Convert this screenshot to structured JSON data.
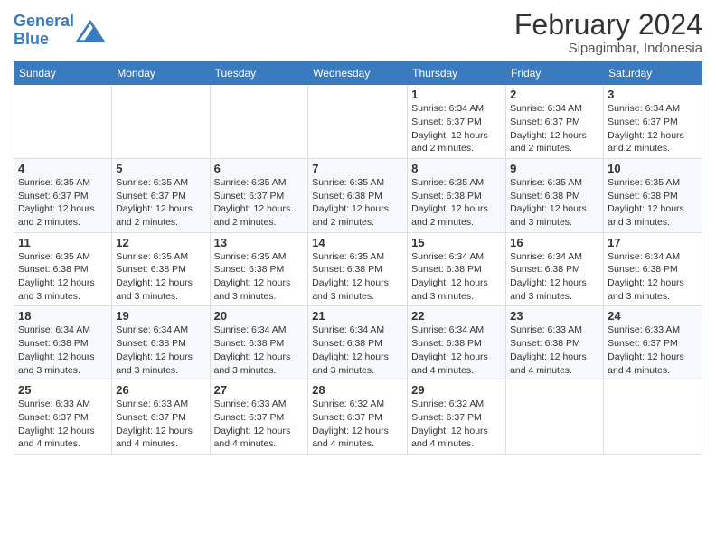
{
  "logo": {
    "line1": "General",
    "line2": "Blue"
  },
  "title": "February 2024",
  "location": "Sipagimbar, Indonesia",
  "days_header": [
    "Sunday",
    "Monday",
    "Tuesday",
    "Wednesday",
    "Thursday",
    "Friday",
    "Saturday"
  ],
  "weeks": [
    [
      {
        "day": "",
        "info": ""
      },
      {
        "day": "",
        "info": ""
      },
      {
        "day": "",
        "info": ""
      },
      {
        "day": "",
        "info": ""
      },
      {
        "day": "1",
        "info": "Sunrise: 6:34 AM\nSunset: 6:37 PM\nDaylight: 12 hours\nand 2 minutes."
      },
      {
        "day": "2",
        "info": "Sunrise: 6:34 AM\nSunset: 6:37 PM\nDaylight: 12 hours\nand 2 minutes."
      },
      {
        "day": "3",
        "info": "Sunrise: 6:34 AM\nSunset: 6:37 PM\nDaylight: 12 hours\nand 2 minutes."
      }
    ],
    [
      {
        "day": "4",
        "info": "Sunrise: 6:35 AM\nSunset: 6:37 PM\nDaylight: 12 hours\nand 2 minutes."
      },
      {
        "day": "5",
        "info": "Sunrise: 6:35 AM\nSunset: 6:37 PM\nDaylight: 12 hours\nand 2 minutes."
      },
      {
        "day": "6",
        "info": "Sunrise: 6:35 AM\nSunset: 6:37 PM\nDaylight: 12 hours\nand 2 minutes."
      },
      {
        "day": "7",
        "info": "Sunrise: 6:35 AM\nSunset: 6:38 PM\nDaylight: 12 hours\nand 2 minutes."
      },
      {
        "day": "8",
        "info": "Sunrise: 6:35 AM\nSunset: 6:38 PM\nDaylight: 12 hours\nand 2 minutes."
      },
      {
        "day": "9",
        "info": "Sunrise: 6:35 AM\nSunset: 6:38 PM\nDaylight: 12 hours\nand 3 minutes."
      },
      {
        "day": "10",
        "info": "Sunrise: 6:35 AM\nSunset: 6:38 PM\nDaylight: 12 hours\nand 3 minutes."
      }
    ],
    [
      {
        "day": "11",
        "info": "Sunrise: 6:35 AM\nSunset: 6:38 PM\nDaylight: 12 hours\nand 3 minutes."
      },
      {
        "day": "12",
        "info": "Sunrise: 6:35 AM\nSunset: 6:38 PM\nDaylight: 12 hours\nand 3 minutes."
      },
      {
        "day": "13",
        "info": "Sunrise: 6:35 AM\nSunset: 6:38 PM\nDaylight: 12 hours\nand 3 minutes."
      },
      {
        "day": "14",
        "info": "Sunrise: 6:35 AM\nSunset: 6:38 PM\nDaylight: 12 hours\nand 3 minutes."
      },
      {
        "day": "15",
        "info": "Sunrise: 6:34 AM\nSunset: 6:38 PM\nDaylight: 12 hours\nand 3 minutes."
      },
      {
        "day": "16",
        "info": "Sunrise: 6:34 AM\nSunset: 6:38 PM\nDaylight: 12 hours\nand 3 minutes."
      },
      {
        "day": "17",
        "info": "Sunrise: 6:34 AM\nSunset: 6:38 PM\nDaylight: 12 hours\nand 3 minutes."
      }
    ],
    [
      {
        "day": "18",
        "info": "Sunrise: 6:34 AM\nSunset: 6:38 PM\nDaylight: 12 hours\nand 3 minutes."
      },
      {
        "day": "19",
        "info": "Sunrise: 6:34 AM\nSunset: 6:38 PM\nDaylight: 12 hours\nand 3 minutes."
      },
      {
        "day": "20",
        "info": "Sunrise: 6:34 AM\nSunset: 6:38 PM\nDaylight: 12 hours\nand 3 minutes."
      },
      {
        "day": "21",
        "info": "Sunrise: 6:34 AM\nSunset: 6:38 PM\nDaylight: 12 hours\nand 3 minutes."
      },
      {
        "day": "22",
        "info": "Sunrise: 6:34 AM\nSunset: 6:38 PM\nDaylight: 12 hours\nand 4 minutes."
      },
      {
        "day": "23",
        "info": "Sunrise: 6:33 AM\nSunset: 6:38 PM\nDaylight: 12 hours\nand 4 minutes."
      },
      {
        "day": "24",
        "info": "Sunrise: 6:33 AM\nSunset: 6:37 PM\nDaylight: 12 hours\nand 4 minutes."
      }
    ],
    [
      {
        "day": "25",
        "info": "Sunrise: 6:33 AM\nSunset: 6:37 PM\nDaylight: 12 hours\nand 4 minutes."
      },
      {
        "day": "26",
        "info": "Sunrise: 6:33 AM\nSunset: 6:37 PM\nDaylight: 12 hours\nand 4 minutes."
      },
      {
        "day": "27",
        "info": "Sunrise: 6:33 AM\nSunset: 6:37 PM\nDaylight: 12 hours\nand 4 minutes."
      },
      {
        "day": "28",
        "info": "Sunrise: 6:32 AM\nSunset: 6:37 PM\nDaylight: 12 hours\nand 4 minutes."
      },
      {
        "day": "29",
        "info": "Sunrise: 6:32 AM\nSunset: 6:37 PM\nDaylight: 12 hours\nand 4 minutes."
      },
      {
        "day": "",
        "info": ""
      },
      {
        "day": "",
        "info": ""
      }
    ]
  ]
}
